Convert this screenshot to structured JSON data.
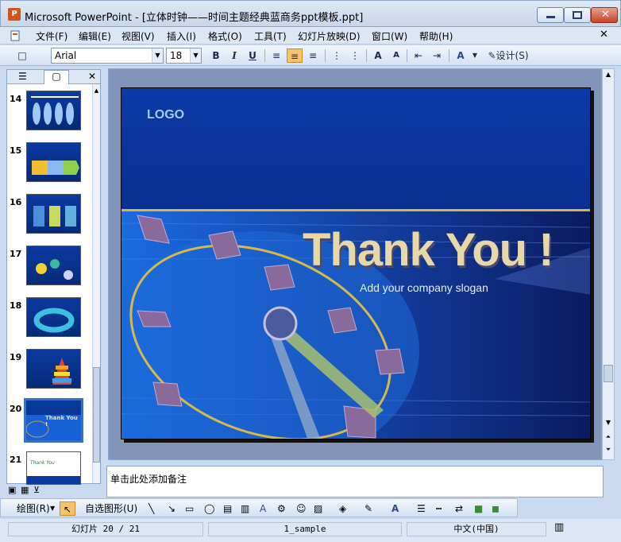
{
  "window": {
    "title": "Microsoft PowerPoint - [立体时钟——时间主题经典蓝商务ppt模板.ppt]"
  },
  "menu": [
    "文件(F)",
    "编辑(E)",
    "视图(V)",
    "插入(I)",
    "格式(O)",
    "工具(T)",
    "幻灯片放映(D)",
    "窗口(W)",
    "帮助(H)"
  ],
  "toolbar": {
    "font": "Arial",
    "size": "18",
    "bold": "B",
    "italic": "I",
    "underline": "U",
    "design": "设计(S)"
  },
  "thumbnails": [
    {
      "num": "14"
    },
    {
      "num": "15"
    },
    {
      "num": "16"
    },
    {
      "num": "17"
    },
    {
      "num": "18"
    },
    {
      "num": "19"
    },
    {
      "num": "20"
    },
    {
      "num": "21"
    }
  ],
  "slide": {
    "logo": "LOGO",
    "heading": "Thank You !",
    "slogan": "Add your company slogan"
  },
  "thumb20": {
    "text": "Thank You !"
  },
  "thumb21": {
    "text": "Thank You"
  },
  "notes": {
    "placeholder": "单击此处添加备注"
  },
  "drawing": {
    "draw": "绘图(R)",
    "autoshapes": "自选图形(U)"
  },
  "status": {
    "slide": "幻灯片 20 / 21",
    "design": "1_sample",
    "language": "中文(中国)"
  }
}
